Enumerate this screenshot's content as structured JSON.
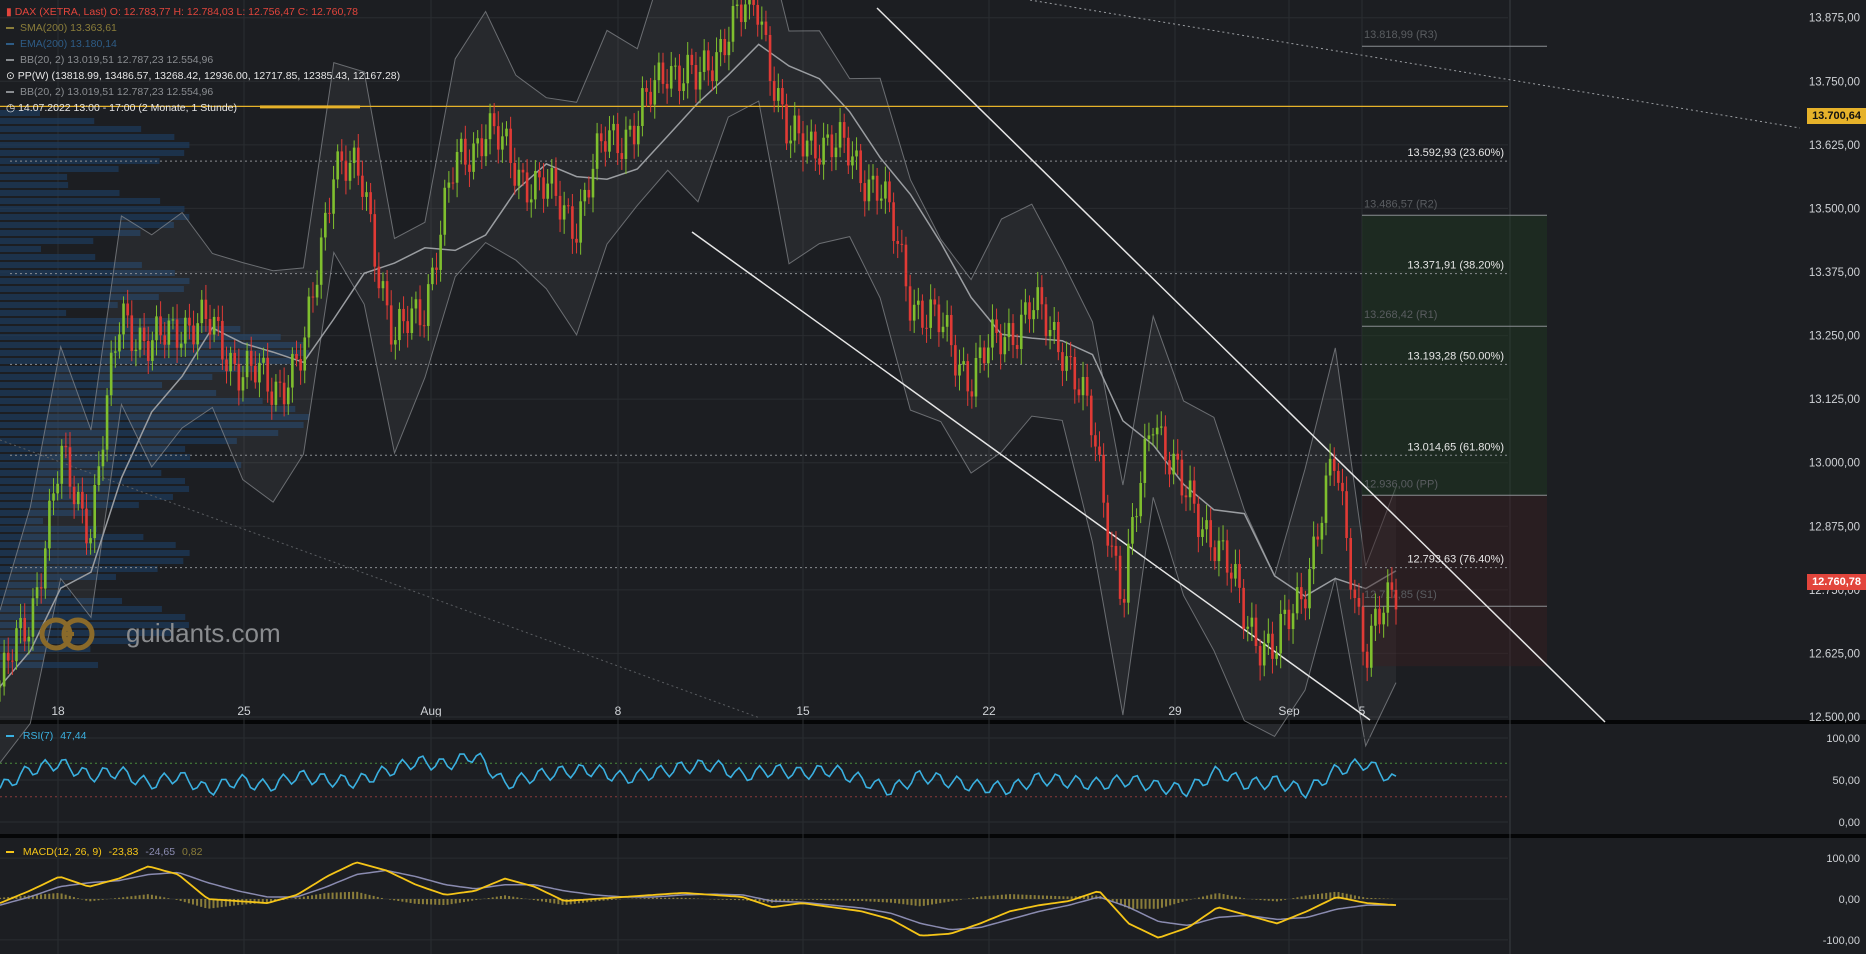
{
  "legend": {
    "ohlc": "DAX (XETRA, Last)  O: 12.783,77  H: 12.784,03  L: 12.756,47  C: 12.760,78",
    "sma": "SMA(200)  13.363,61",
    "ema": "EMA(200)  13.180,14",
    "bb1": "BB(20, 2)  13.019,51  12.787,23  12.554,96",
    "pp": "PP(W)  (13818.99, 13486.57, 13268.42, 12936.00, 12717.85, 12385.43, 12167.28)",
    "bb2": "BB(20, 2)  13.019,51  12.787,23  12.554,96",
    "time": "14.07.2022 13:00 - 17:00   (2 Monate, 1 Stunde)"
  },
  "watermark": "guidants.com",
  "price_tags": {
    "hline": "13.700,64",
    "last": "12.760,78"
  },
  "colors": {
    "bull": "#7fbf2e",
    "bear": "#e03a35",
    "bb": "#8a8d91",
    "sma": "#8a8d91",
    "hline": "#e6b22a",
    "rsi": "#3ab0e0",
    "macd": "#f5c518",
    "signal": "#8a8bb0",
    "hist": "#8a7d3a",
    "last_tag": "#e2453c",
    "grid": "#2a2d31"
  },
  "rsi_legend": {
    "name": "RSI(7)",
    "value": "47,44"
  },
  "macd_legend": {
    "name": "MACD(12, 26, 9)",
    "v1": "-23,83",
    "v2": "-24,65",
    "v3": "0,82"
  },
  "chart_data": [
    {
      "type": "candlestick",
      "title": "DAX (XETRA, Last)",
      "ylim": [
        12500,
        13900
      ],
      "yticks": [
        12500,
        12625,
        12750,
        12875,
        13000,
        13125,
        13250,
        13375,
        13500,
        13625,
        13750,
        13875
      ],
      "ytick_labels": [
        "12.500,00",
        "12.625,00",
        "12.750,00",
        "12.875,00",
        "13.000,00",
        "13.125,00",
        "13.250,00",
        "13.375,00",
        "13.500,00",
        "13.625,00",
        "13.750,00",
        "13.875,00"
      ],
      "xtick_labels": [
        "18",
        "25",
        "Aug",
        "8",
        "15",
        "22",
        "29",
        "Sep",
        "5"
      ],
      "close_path": [
        [
          0,
          12560
        ],
        [
          1,
          12700
        ],
        [
          2,
          13000
        ],
        [
          3,
          12880
        ],
        [
          4,
          13300
        ],
        [
          5,
          13220
        ],
        [
          6,
          13280
        ],
        [
          7,
          13260
        ],
        [
          8,
          13180
        ],
        [
          9,
          13150
        ],
        [
          10,
          13200
        ],
        [
          11,
          13600
        ],
        [
          12,
          13540
        ],
        [
          13,
          13230
        ],
        [
          14,
          13320
        ],
        [
          15,
          13580
        ],
        [
          16,
          13660
        ],
        [
          17,
          13580
        ],
        [
          18,
          13530
        ],
        [
          19,
          13480
        ],
        [
          20,
          13640
        ],
        [
          21,
          13660
        ],
        [
          22,
          13790
        ],
        [
          23,
          13740
        ],
        [
          24,
          13860
        ],
        [
          25,
          13900
        ],
        [
          26,
          13620
        ],
        [
          27,
          13640
        ],
        [
          28,
          13600
        ],
        [
          29,
          13540
        ],
        [
          30,
          13330
        ],
        [
          31,
          13260
        ],
        [
          32,
          13170
        ],
        [
          33,
          13250
        ],
        [
          34,
          13300
        ],
        [
          35,
          13240
        ],
        [
          36,
          13060
        ],
        [
          37,
          12730
        ],
        [
          38,
          13110
        ],
        [
          39,
          12930
        ],
        [
          40,
          12860
        ],
        [
          41,
          12700
        ],
        [
          42,
          12620
        ],
        [
          43,
          12770
        ],
        [
          44,
          13000
        ],
        [
          45,
          12620
        ],
        [
          46,
          12760
        ]
      ],
      "fib_levels": [
        {
          "label": "13.592,93 (23.60%)",
          "value": 13592.93
        },
        {
          "label": "13.371,91 (38.20%)",
          "value": 13371.91
        },
        {
          "label": "13.193,28 (50.00%)",
          "value": 13193.28
        },
        {
          "label": "13.014,65 (61.80%)",
          "value": 13014.65
        },
        {
          "label": "12.793,63 (76.40%)",
          "value": 12793.63
        }
      ],
      "pivots": [
        {
          "label": "13.818,99 (R3)",
          "value": 13818.99
        },
        {
          "label": "13.486,57 (R2)",
          "value": 13486.57
        },
        {
          "label": "13.268,42 (R1)",
          "value": 13268.42
        },
        {
          "label": "12.936,00 (PP)",
          "value": 12936.0
        },
        {
          "label": "12.717,85 (S1)",
          "value": 12717.85
        }
      ],
      "hline": 13700.64,
      "last": 12760.78
    },
    {
      "type": "line",
      "title": "RSI(7)",
      "ylim": [
        0,
        100
      ],
      "ytick_labels": [
        "100,00",
        "50,00",
        "0,00"
      ],
      "levels": [
        70,
        30
      ],
      "values": [
        40,
        62,
        70,
        55,
        60,
        45,
        55,
        38,
        50,
        42,
        55,
        50,
        48,
        60,
        72,
        68,
        80,
        45,
        55,
        60,
        62,
        52,
        58,
        65,
        68,
        55,
        62,
        58,
        62,
        50,
        38,
        55,
        48,
        42,
        40,
        52,
        48,
        45,
        50,
        42,
        38,
        60,
        45,
        48,
        36,
        62,
        70,
        48
      ]
    },
    {
      "type": "line",
      "title": "MACD(12, 26, 9)",
      "ylim": [
        -120,
        120
      ],
      "ytick_labels": [
        "100,00",
        "0,00",
        "-100,00"
      ],
      "macd": [
        -10,
        20,
        55,
        30,
        50,
        80,
        60,
        0,
        -5,
        -10,
        10,
        55,
        90,
        70,
        35,
        10,
        20,
        50,
        30,
        -5,
        0,
        5,
        10,
        15,
        10,
        5,
        -20,
        -10,
        -20,
        -30,
        -50,
        -90,
        -85,
        -60,
        -30,
        -15,
        -5,
        20,
        -60,
        -95,
        -70,
        -20,
        -40,
        -60,
        -30,
        5,
        -10,
        -15
      ],
      "signal": [
        -15,
        5,
        30,
        40,
        45,
        60,
        65,
        40,
        20,
        5,
        5,
        30,
        60,
        70,
        55,
        35,
        25,
        35,
        35,
        20,
        10,
        5,
        5,
        10,
        12,
        10,
        -5,
        -8,
        -15,
        -22,
        -35,
        -60,
        -75,
        -70,
        -50,
        -30,
        -15,
        5,
        -20,
        -55,
        -65,
        -45,
        -40,
        -50,
        -45,
        -25,
        -15,
        -15
      ]
    }
  ]
}
